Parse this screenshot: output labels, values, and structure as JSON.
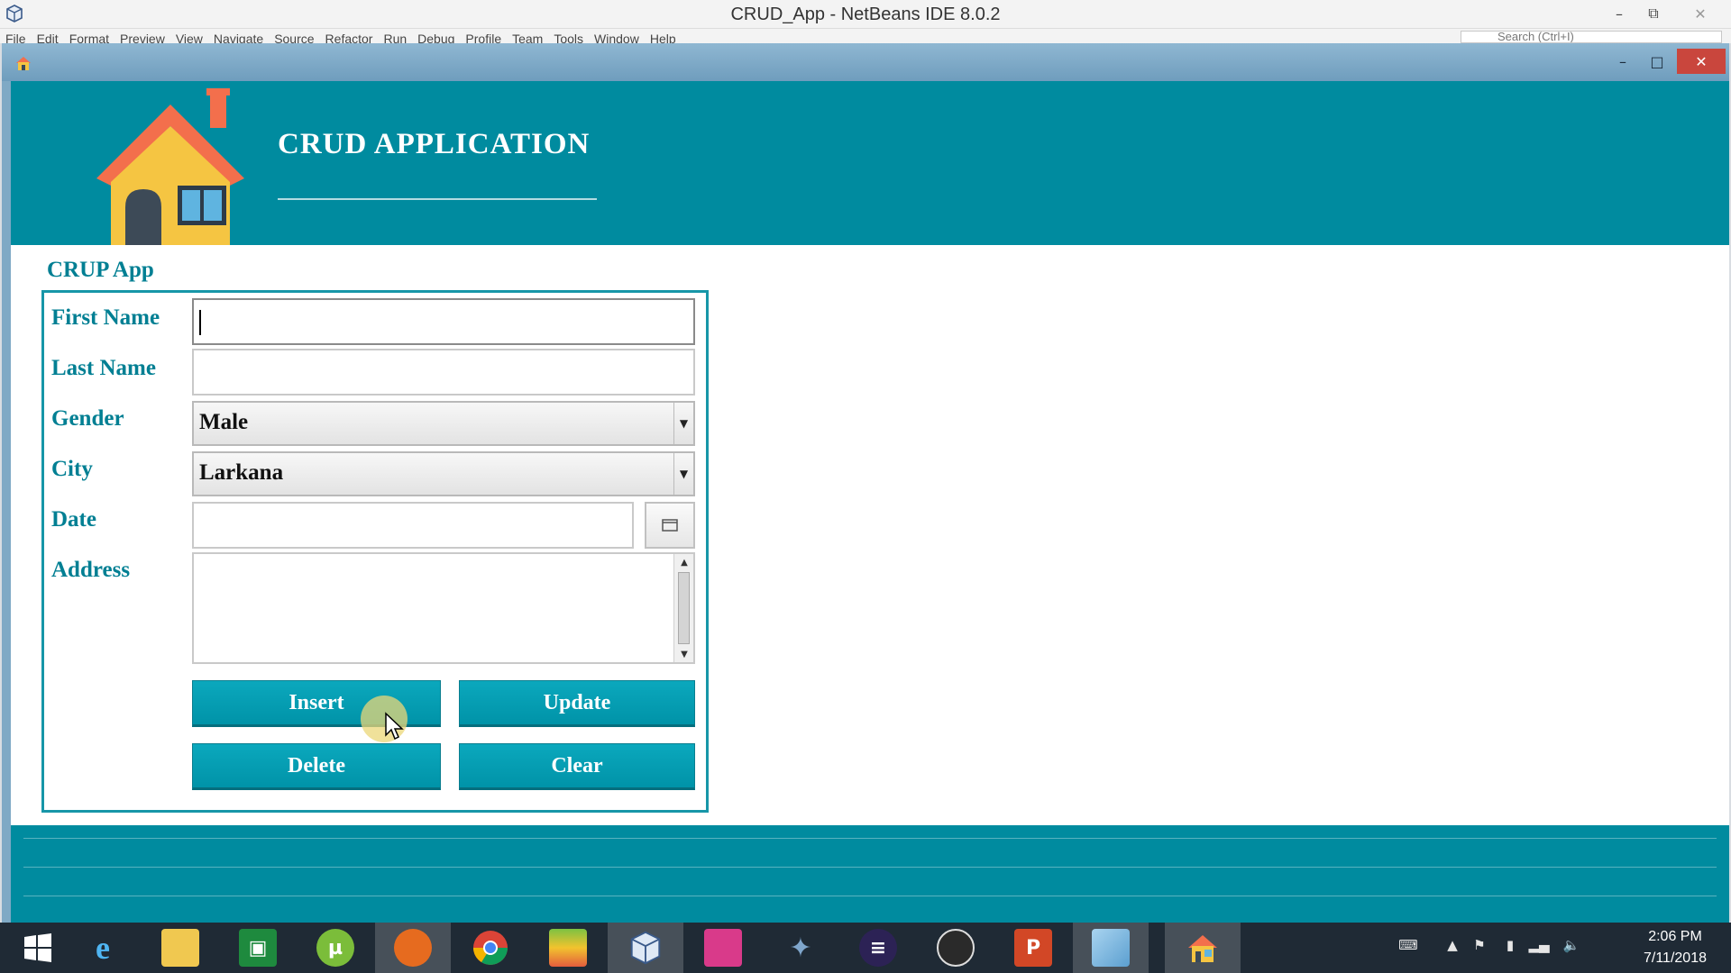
{
  "ide": {
    "title": "CRUD_App - NetBeans IDE 8.0.2",
    "menu": [
      "File",
      "Edit",
      "Format",
      "Preview",
      "View",
      "Navigate",
      "Source",
      "Refactor",
      "Run",
      "Debug",
      "Profile",
      "Team",
      "Tools",
      "Window",
      "Help"
    ],
    "search_placeholder": "Search (Ctrl+I)"
  },
  "app": {
    "heading": "CRUD APPLICATION",
    "panel_title": "CRUP App",
    "fields": {
      "first_name_label": "First Name",
      "first_name_value": "",
      "last_name_label": "Last Name",
      "last_name_value": "",
      "gender_label": "Gender",
      "gender_value": "Male",
      "city_label": "City",
      "city_value": "Larkana",
      "date_label": "Date",
      "date_value": "",
      "address_label": "Address",
      "address_value": ""
    },
    "buttons": {
      "insert": "Insert",
      "update": "Update",
      "delete": "Delete",
      "clear": "Clear"
    },
    "colors": {
      "header": "#008b9f",
      "accent_text": "#007f93",
      "button": "#0093a8"
    }
  },
  "taskbar": {
    "items": [
      {
        "name": "start",
        "icon": "windows-logo-icon"
      },
      {
        "name": "internet-explorer",
        "icon": "internet-explorer-icon"
      },
      {
        "name": "file-explorer",
        "icon": "folder-icon"
      },
      {
        "name": "store",
        "icon": "store-icon"
      },
      {
        "name": "utorrent",
        "icon": "utorrent-icon"
      },
      {
        "name": "firefox",
        "icon": "firefox-icon"
      },
      {
        "name": "chrome",
        "icon": "chrome-icon"
      },
      {
        "name": "books",
        "icon": "books-icon"
      },
      {
        "name": "netbeans",
        "icon": "netbeans-cube-icon"
      },
      {
        "name": "app-pink",
        "icon": "pink-app-icon"
      },
      {
        "name": "mysql",
        "icon": "dolphin-icon"
      },
      {
        "name": "eclipse",
        "icon": "eclipse-icon"
      },
      {
        "name": "obs",
        "icon": "obs-icon"
      },
      {
        "name": "powerpoint",
        "icon": "powerpoint-icon"
      },
      {
        "name": "notepad",
        "icon": "notepad-icon"
      },
      {
        "name": "crud-app",
        "icon": "home-icon"
      }
    ],
    "clock_time": "2:06 PM",
    "clock_date": "7/11/2018"
  }
}
